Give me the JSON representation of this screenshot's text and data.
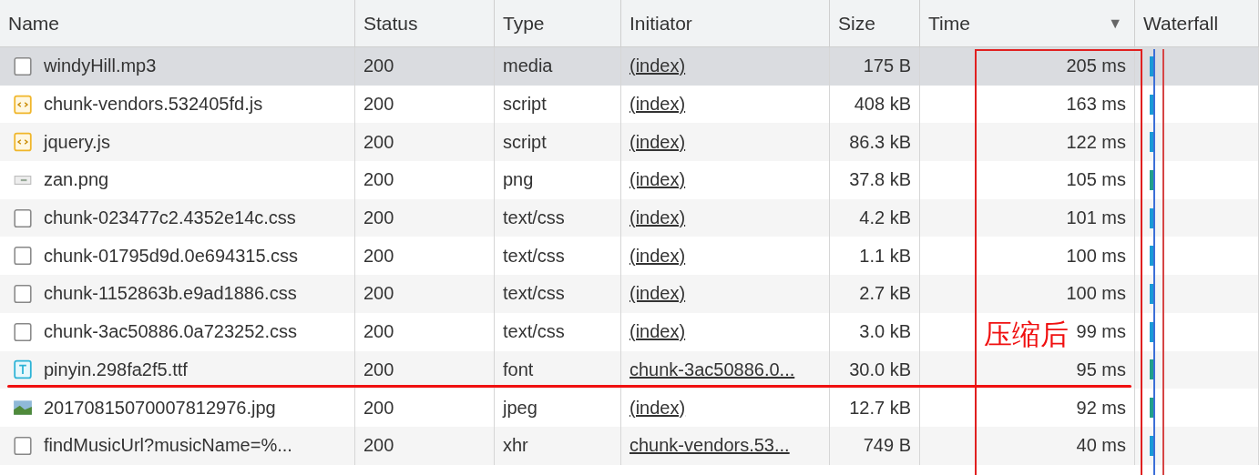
{
  "table": {
    "columns": [
      {
        "label": "Name"
      },
      {
        "label": "Status"
      },
      {
        "label": "Type"
      },
      {
        "label": "Initiator"
      },
      {
        "label": "Size"
      },
      {
        "label": "Time",
        "sort_indicator": "▼"
      },
      {
        "label": "Waterfall"
      }
    ],
    "rows": [
      {
        "kind": "file",
        "name": "windyHill.mp3",
        "status": "200",
        "type": "media",
        "initiator": "(index)",
        "size": "175 B",
        "time": "205 ms",
        "selected": true
      },
      {
        "kind": "script",
        "name": "chunk-vendors.532405fd.js",
        "status": "200",
        "type": "script",
        "initiator": "(index)",
        "size": "408 kB",
        "time": "163 ms",
        "selected": false
      },
      {
        "kind": "script",
        "name": "jquery.js",
        "status": "200",
        "type": "script",
        "initiator": "(index)",
        "size": "86.3 kB",
        "time": "122 ms",
        "selected": false
      },
      {
        "kind": "image",
        "name": "zan.png",
        "status": "200",
        "type": "png",
        "initiator": "(index)",
        "size": "37.8 kB",
        "time": "105 ms",
        "selected": false
      },
      {
        "kind": "file",
        "name": "chunk-023477c2.4352e14c.css",
        "status": "200",
        "type": "text/css",
        "initiator": "(index)",
        "size": "4.2 kB",
        "time": "101 ms",
        "selected": false
      },
      {
        "kind": "file",
        "name": "chunk-01795d9d.0e694315.css",
        "status": "200",
        "type": "text/css",
        "initiator": "(index)",
        "size": "1.1 kB",
        "time": "100 ms",
        "selected": false
      },
      {
        "kind": "file",
        "name": "chunk-1152863b.e9ad1886.css",
        "status": "200",
        "type": "text/css",
        "initiator": "(index)",
        "size": "2.7 kB",
        "time": "100 ms",
        "selected": false
      },
      {
        "kind": "file",
        "name": "chunk-3ac50886.0a723252.css",
        "status": "200",
        "type": "text/css",
        "initiator": "(index)",
        "size": "3.0 kB",
        "time": "99 ms",
        "selected": false
      },
      {
        "kind": "font",
        "name": "pinyin.298fa2f5.ttf",
        "status": "200",
        "type": "font",
        "initiator": "chunk-3ac50886.0...",
        "size": "30.0 kB",
        "time": "95 ms",
        "selected": false
      },
      {
        "kind": "photo",
        "name": "20170815070007812976.jpg",
        "status": "200",
        "type": "jpeg",
        "initiator": "(index)",
        "size": "12.7 kB",
        "time": "92 ms",
        "selected": false
      },
      {
        "kind": "file",
        "name": "findMusicUrl?musicName=%...",
        "status": "200",
        "type": "xhr",
        "initiator": "chunk-vendors.53...",
        "size": "749 B",
        "time": "40 ms",
        "selected": false
      }
    ]
  },
  "annotation": {
    "label": "压缩后"
  }
}
